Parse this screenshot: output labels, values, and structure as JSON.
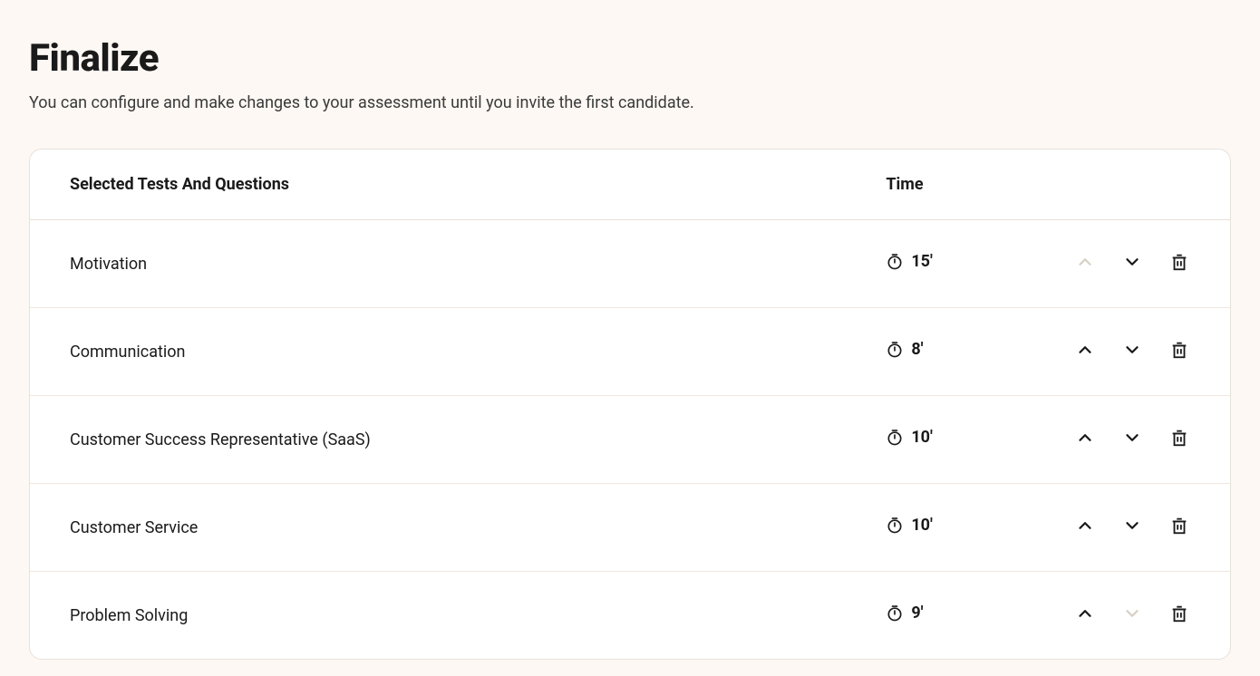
{
  "page": {
    "title": "Finalize",
    "subtitle": "You can configure and make changes to your assessment until you invite the first candidate."
  },
  "table": {
    "headers": {
      "name": "Selected Tests And Questions",
      "time": "Time"
    },
    "rows": [
      {
        "name": "Motivation",
        "time": "15'",
        "can_move_up": false,
        "can_move_down": true
      },
      {
        "name": "Communication",
        "time": "8'",
        "can_move_up": true,
        "can_move_down": true
      },
      {
        "name": "Customer Success Representative (SaaS)",
        "time": "10'",
        "can_move_up": true,
        "can_move_down": true
      },
      {
        "name": "Customer Service",
        "time": "10'",
        "can_move_up": true,
        "can_move_down": true
      },
      {
        "name": "Problem Solving",
        "time": "9'",
        "can_move_up": true,
        "can_move_down": false
      }
    ]
  }
}
